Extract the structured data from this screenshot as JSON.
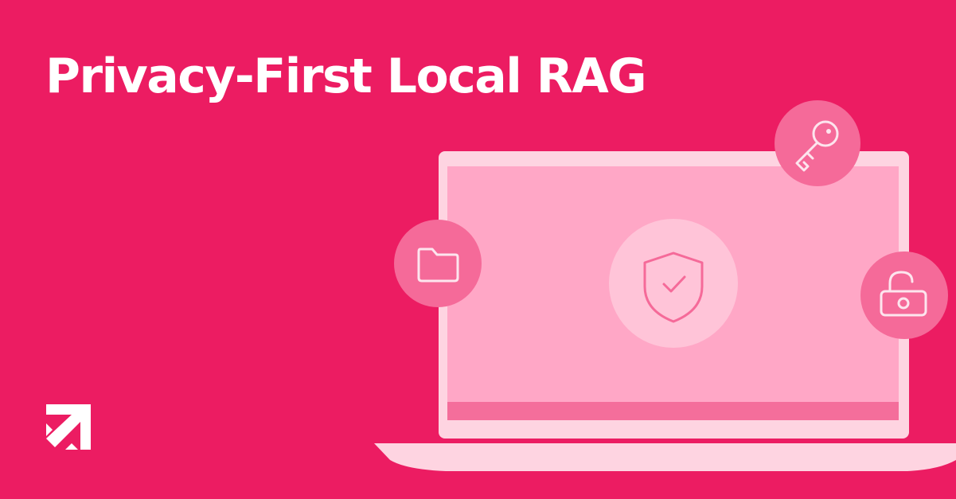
{
  "page": {
    "title": "Privacy-First Local RAG"
  },
  "colors": {
    "background": "#EC1C62",
    "laptop_body": "#FED4E1",
    "laptop_screen": "#FFA7C6",
    "taskbar": "#F46E9B",
    "icon_badge": "#F56A99",
    "center_badge": "#FFC4D8",
    "icon_stroke": "#FDE5EE",
    "text": "#FFFFFF"
  },
  "icons": {
    "logo": "arrow-up-right-logo",
    "folder": "folder-icon",
    "shield": "shield-check-icon",
    "key": "key-icon",
    "lock": "unlocked-padlock-icon"
  }
}
